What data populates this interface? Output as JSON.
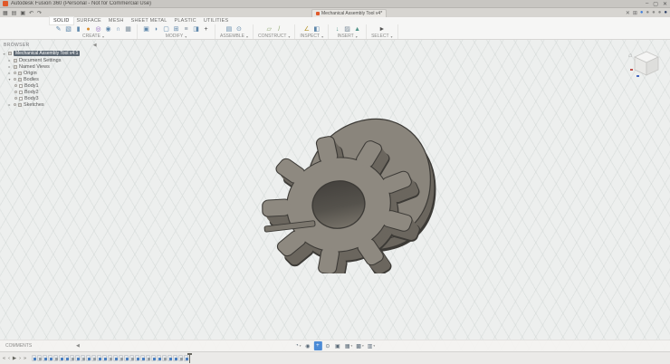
{
  "window": {
    "title": "Autodesk Fusion 360 (Personal - Not for Commercial Use)",
    "controls": {
      "minimize": "–",
      "maximize": "▢",
      "close": "✕"
    }
  },
  "quick_access": {
    "items": [
      {
        "name": "data-panel-icon",
        "glyph": "▦"
      },
      {
        "name": "file-menu-icon",
        "glyph": "▤"
      },
      {
        "name": "save-icon",
        "glyph": "▣"
      },
      {
        "name": "undo-icon",
        "glyph": "↶"
      },
      {
        "name": "redo-icon",
        "glyph": "↷"
      }
    ]
  },
  "document_tab": {
    "label": "Mechanical Assembly Tool v4*"
  },
  "app_bar_right": {
    "items": [
      {
        "name": "tab-close-icon",
        "glyph": "✕",
        "color": "#6a6a6a"
      },
      {
        "name": "extensions-icon",
        "glyph": "⊞",
        "color": "#6a6a6a"
      },
      {
        "name": "sync-status-icon",
        "glyph": "●",
        "color": "#3d7edb"
      },
      {
        "name": "job-status-icon",
        "glyph": "●",
        "color": "#8a8a88"
      },
      {
        "name": "notifications-icon",
        "glyph": "●",
        "color": "#8a8a88"
      },
      {
        "name": "help-icon",
        "glyph": "●",
        "color": "#8a8a88"
      },
      {
        "name": "profile-avatar",
        "glyph": "●",
        "color": "#2c3e66"
      }
    ]
  },
  "toolbar": {
    "caret": "▾",
    "tabs": [
      {
        "label": "SOLID",
        "active": true
      },
      {
        "label": "SURFACE"
      },
      {
        "label": "MESH"
      },
      {
        "label": "SHEET METAL"
      },
      {
        "label": "PLASTIC"
      },
      {
        "label": "UTILITIES"
      }
    ],
    "groups": [
      {
        "label": "CREATE",
        "caret": "▾",
        "icons": [
          {
            "name": "create-sketch-icon",
            "glyph": "✎",
            "color": "#5e87ab"
          },
          {
            "name": "box-icon",
            "glyph": "▧",
            "color": "#5e87ab"
          },
          {
            "name": "cylinder-icon",
            "glyph": "▮",
            "color": "#5e87ab"
          },
          {
            "name": "sphere-icon",
            "glyph": "●",
            "color": "#d98b2b"
          },
          {
            "name": "torus-icon",
            "glyph": "◎",
            "color": "#9068bf"
          },
          {
            "name": "coil-icon",
            "glyph": "◉",
            "color": "#5e87ab"
          },
          {
            "name": "pipe-icon",
            "glyph": "∩",
            "color": "#5e87ab"
          },
          {
            "name": "pattern-icon",
            "glyph": "▦",
            "color": "#7a8b99"
          }
        ]
      },
      {
        "label": "MODIFY",
        "caret": "▾",
        "icons": [
          {
            "name": "press-pull-icon",
            "glyph": "▣",
            "color": "#5e87ab"
          },
          {
            "name": "fillet-icon",
            "glyph": "◗",
            "color": "#5e87ab"
          },
          {
            "name": "shell-icon",
            "glyph": "▢",
            "color": "#5e87ab"
          },
          {
            "name": "combine-icon",
            "glyph": "⊞",
            "color": "#5e87ab"
          },
          {
            "name": "offset-face-icon",
            "glyph": "≡",
            "color": "#7a8b99"
          },
          {
            "name": "split-body-icon",
            "glyph": "◨",
            "color": "#5e87ab"
          },
          {
            "name": "move-copy-icon",
            "glyph": "+",
            "color": "#444444"
          }
        ]
      },
      {
        "label": "ASSEMBLE",
        "caret": "▾",
        "icons": [
          {
            "name": "new-component-icon",
            "glyph": "▤",
            "color": "#5e87ab"
          },
          {
            "name": "joint-icon",
            "glyph": "⊙",
            "color": "#5e87ab"
          }
        ]
      },
      {
        "label": "CONSTRUCT",
        "caret": "▾",
        "icons": [
          {
            "name": "offset-plane-icon",
            "glyph": "▱",
            "color": "#8aa568"
          },
          {
            "name": "axis-icon",
            "glyph": "/",
            "color": "#8aa568"
          }
        ]
      },
      {
        "label": "INSPECT",
        "caret": "▾",
        "icons": [
          {
            "name": "measure-icon",
            "glyph": "∠",
            "color": "#b8952e"
          },
          {
            "name": "section-analysis-icon",
            "glyph": "◧",
            "color": "#5e87ab"
          }
        ]
      },
      {
        "label": "INSERT",
        "caret": "▾",
        "icons": [
          {
            "name": "insert-derive-icon",
            "glyph": "↓",
            "color": "#52958a"
          },
          {
            "name": "decal-icon",
            "glyph": "▨",
            "color": "#7a8b99"
          },
          {
            "name": "insert-mesh-icon",
            "glyph": "▲",
            "color": "#52958a"
          }
        ]
      },
      {
        "label": "SELECT",
        "caret": "▾",
        "icons": [
          {
            "name": "select-icon",
            "glyph": "►",
            "color": "#555555"
          }
        ]
      }
    ]
  },
  "browser": {
    "header": "BROWSER",
    "collapse_icon": "◀",
    "root": {
      "label": "Mechanical Assembly Tool v4:1"
    },
    "items": [
      {
        "label": "Document Settings"
      },
      {
        "label": "Named Views"
      },
      {
        "label": "Origin"
      },
      {
        "label": "Bodies"
      },
      {
        "label": "Sketches"
      }
    ],
    "bodies": [
      {
        "label": "Body1"
      },
      {
        "label": "Body2"
      },
      {
        "label": "Body3"
      }
    ]
  },
  "viewcube": {
    "home_icon": "⌂"
  },
  "model": {
    "description": "gear body with center bore and keyway slot in front of rounded cam-shaped body",
    "face_color": "#8e8980",
    "side_color": "#6b665e",
    "outline_color": "#3c3a36"
  },
  "comments": {
    "label": "COMMENTS",
    "collapse_icon": "◀"
  },
  "navbar": {
    "items": [
      {
        "name": "orbit-icon",
        "glyph": "◔",
        "caret": "▾"
      },
      {
        "name": "look-at-icon",
        "glyph": "◉"
      },
      {
        "name": "pan-icon",
        "glyph": "+",
        "active": true
      },
      {
        "name": "zoom-icon",
        "glyph": "⊙"
      },
      {
        "name": "fit-icon",
        "glyph": "▣"
      },
      {
        "name": "display-settings-icon",
        "glyph": "▦",
        "caret": "▾"
      },
      {
        "name": "grid-snaps-icon",
        "glyph": "▩",
        "caret": "▾"
      },
      {
        "name": "viewports-icon",
        "glyph": "▥",
        "caret": "▾"
      }
    ]
  },
  "timeline": {
    "controls": [
      {
        "name": "skip-to-start-icon",
        "glyph": "«"
      },
      {
        "name": "step-back-icon",
        "glyph": "‹"
      },
      {
        "name": "play-icon",
        "glyph": "▶"
      },
      {
        "name": "step-forward-icon",
        "glyph": "›"
      },
      {
        "name": "skip-to-end-icon",
        "glyph": "»"
      }
    ],
    "features": [
      {
        "type": "sketch"
      },
      {
        "type": "feature"
      },
      {
        "type": "sketch"
      },
      {
        "type": "sketch"
      },
      {
        "type": "feature"
      },
      {
        "type": "sketch"
      },
      {
        "type": "sketch"
      },
      {
        "type": "feature"
      },
      {
        "type": "sketch"
      },
      {
        "type": "feature"
      },
      {
        "type": "sketch"
      },
      {
        "type": "feature"
      },
      {
        "type": "sketch"
      },
      {
        "type": "sketch"
      },
      {
        "type": "feature"
      },
      {
        "type": "sketch"
      },
      {
        "type": "feature"
      },
      {
        "type": "sketch"
      },
      {
        "type": "feature"
      },
      {
        "type": "sketch"
      },
      {
        "type": "sketch"
      },
      {
        "type": "feature"
      },
      {
        "type": "sketch"
      },
      {
        "type": "sketch"
      },
      {
        "type": "feature"
      },
      {
        "type": "sketch"
      },
      {
        "type": "sketch"
      },
      {
        "type": "feature"
      },
      {
        "type": "sketch"
      }
    ]
  },
  "canvas": {
    "background": "#edefee",
    "grid_line": "#c6cecc"
  }
}
